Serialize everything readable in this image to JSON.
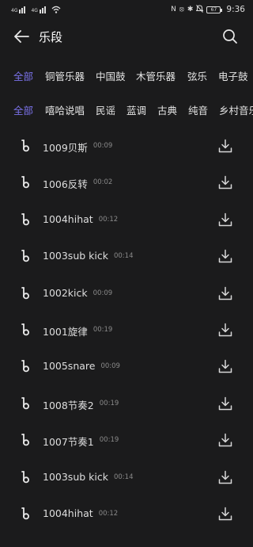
{
  "status": {
    "network_tag_1": "4G",
    "network_tag_2": "4G",
    "nfc": "N",
    "vibrate": "⦻",
    "mute": "🔕",
    "bluetooth": "✱",
    "battery": "67",
    "time": "9:36"
  },
  "header": {
    "title": "乐段",
    "back_icon": "arrow-left-icon",
    "search_icon": "search-icon"
  },
  "category_tabs": [
    {
      "label": "全部",
      "active": true
    },
    {
      "label": "铜管乐器",
      "active": false
    },
    {
      "label": "中国鼓",
      "active": false
    },
    {
      "label": "木管乐器",
      "active": false
    },
    {
      "label": "弦乐",
      "active": false
    },
    {
      "label": "电子鼓",
      "active": false
    }
  ],
  "genre_tabs": [
    {
      "label": "全部",
      "active": true
    },
    {
      "label": "嘻哈说唱",
      "active": false
    },
    {
      "label": "民谣",
      "active": false
    },
    {
      "label": "蓝调",
      "active": false
    },
    {
      "label": "古典",
      "active": false
    },
    {
      "label": "纯音",
      "active": false
    },
    {
      "label": "乡村音乐",
      "active": false
    }
  ],
  "clips": [
    {
      "name": "1009贝斯",
      "duration": "00:09"
    },
    {
      "name": "1006反转",
      "duration": "00:02"
    },
    {
      "name": "1004hihat",
      "duration": "00:12"
    },
    {
      "name": "1003sub kick",
      "duration": "00:14"
    },
    {
      "name": "1002kick",
      "duration": "00:09"
    },
    {
      "name": "1001旋律",
      "duration": "00:19"
    },
    {
      "name": "1005snare",
      "duration": "00:09"
    },
    {
      "name": "1008节奏2",
      "duration": "00:19"
    },
    {
      "name": "1007节奏1",
      "duration": "00:19"
    },
    {
      "name": "1003sub kick",
      "duration": "00:14"
    },
    {
      "name": "1004hihat",
      "duration": "00:12"
    }
  ],
  "colors": {
    "background": "#1b1b1c",
    "accent": "#7a71e8",
    "text": "#dedede",
    "muted": "#8a8a8a"
  }
}
